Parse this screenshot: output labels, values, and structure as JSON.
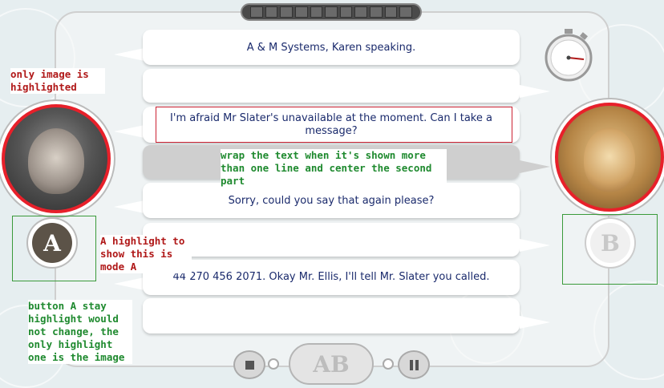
{
  "dialogue": [
    {
      "text": "A & M Systems, Karen speaking."
    },
    {
      "text": ""
    },
    {
      "text": "I'm afraid Mr Slater's unavailable at the moment.  Can I take a message?"
    },
    {
      "text": ""
    },
    {
      "text": "Sorry, could you say that again please?"
    },
    {
      "text": ""
    },
    {
      "text": "44 270 456 2071. Okay Mr. Ellis, I'll tell Mr. Slater you called."
    },
    {
      "text": ""
    }
  ],
  "modes": {
    "a_label": "A",
    "b_label": "B",
    "ab_label": "AB"
  },
  "annotations": {
    "image_only": "only image is highlighted",
    "wrap_text": "wrap the text when it's shown more than one line and center the second part",
    "mode_a": "A highlight to show this is mode A",
    "button_a": "button A stay highlight would not change, the only highlight one is the image"
  },
  "controls": {
    "stop_icon": "stop-icon",
    "pause_icon": "pause-icon",
    "stopwatch_icon": "stopwatch-icon"
  },
  "colors": {
    "highlight_red": "#e8202a",
    "annotation_red": "#b01818",
    "annotation_green": "#1f8a2f",
    "text_blue": "#1a2a6c"
  }
}
